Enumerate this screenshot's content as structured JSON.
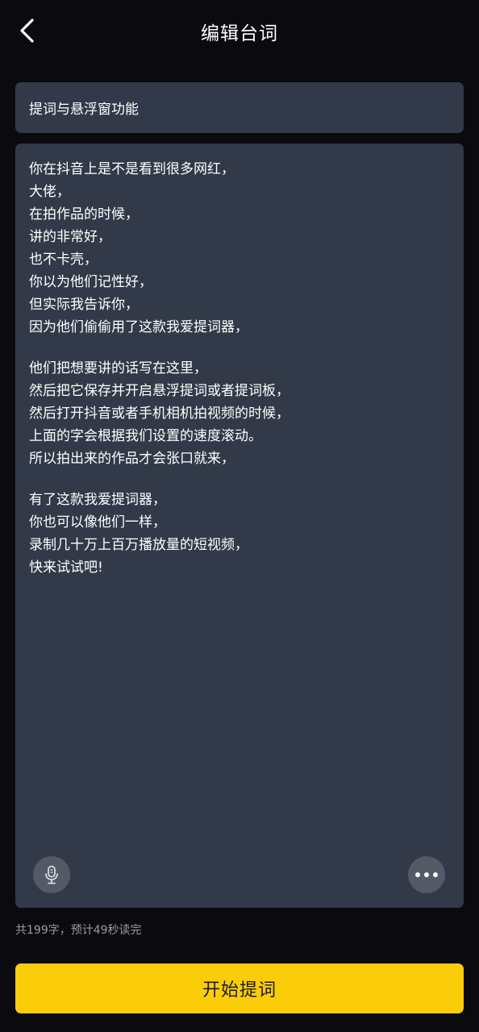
{
  "header": {
    "title": "编辑台词",
    "back_icon": "chevron-left-icon"
  },
  "script_title": {
    "value": "提词与悬浮窗功能"
  },
  "script_body": {
    "paragraphs": [
      {
        "lines": [
          "你在抖音上是不是看到很多网红，",
          "大佬，",
          "在拍作品的时候，",
          "讲的非常好，",
          "也不卡壳，",
          "你以为他们记性好，",
          "但实际我告诉你，",
          "因为他们偷偷用了这款我爱提词器，"
        ]
      },
      {
        "lines": [
          "他们把想要讲的话写在这里，",
          "然后把它保存并开启悬浮提词或者提词板，",
          "然后打开抖音或者手机相机拍视频的时候，",
          "上面的字会根据我们设置的速度滚动。",
          "所以拍出来的作品才会张口就来，"
        ]
      },
      {
        "lines": [
          "有了这款我爱提词器，",
          "你也可以像他们一样，",
          "录制几十万上百万播放量的短视频，",
          "快来试试吧!"
        ]
      }
    ],
    "mic_icon": "microphone-icon",
    "more_icon": "more-horizontal-icon"
  },
  "footer": {
    "count_text": "共199字，预计49秒读完",
    "start_label": "开始提词"
  },
  "colors": {
    "background": "#0b0a0f",
    "panel": "#323a49",
    "accent": "#facd08",
    "muted_text": "#9b9ca3"
  }
}
